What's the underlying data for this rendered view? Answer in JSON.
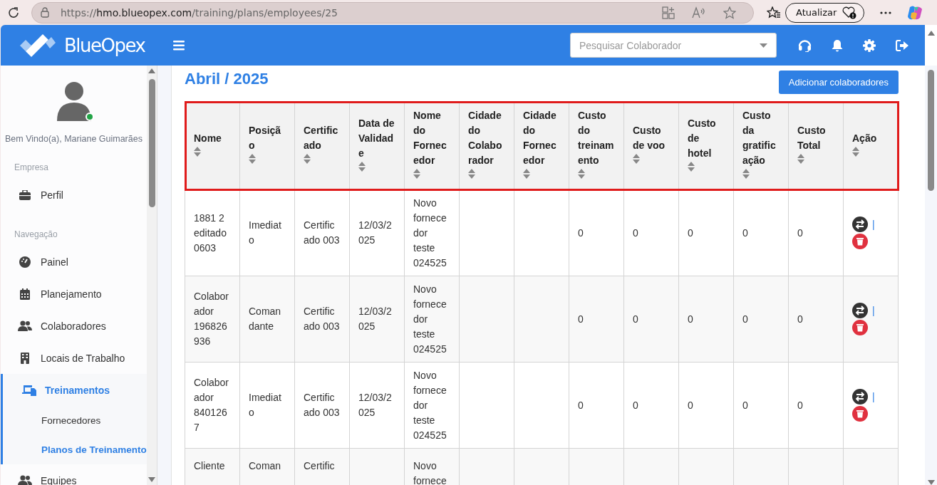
{
  "browser": {
    "url_scheme": "https://",
    "url_host": "hmo.blueopex.com",
    "url_path": "/training/plans/employees/25",
    "update_button": "Atualizar"
  },
  "header": {
    "brand": "BlueOpex",
    "search": {
      "placeholder": "Pesquisar Colaborador"
    }
  },
  "sidebar": {
    "user": {
      "greeting": "Bem Vindo(a), Mariane Guimarães",
      "online": true
    },
    "sections": [
      {
        "title": "Empresa",
        "items": [
          {
            "label": "Perfil",
            "kind": "briefcase",
            "selected": false
          }
        ]
      },
      {
        "title": "Navegação",
        "items": [
          {
            "label": "Painel",
            "kind": "gauge",
            "selected": false
          },
          {
            "label": "Planejamento",
            "kind": "calendar",
            "selected": false
          },
          {
            "label": "Colaboradores",
            "kind": "people",
            "selected": false
          },
          {
            "label": "Locais de Trabalho",
            "kind": "building",
            "selected": false
          },
          {
            "label": "Treinamentos",
            "kind": "devices",
            "selected": true,
            "expanded": true,
            "children": [
              {
                "label": "Fornecedores",
                "selected": false
              },
              {
                "label": "Planos de Treinamento",
                "selected": true
              }
            ]
          },
          {
            "label": "Equipes",
            "kind": "people",
            "selected": false
          }
        ]
      }
    ]
  },
  "page": {
    "title": "Abril / 2025",
    "add_button": "Adicionar colaboradores"
  },
  "table": {
    "header_highlighted": true,
    "columns": [
      "Nome",
      "Posição",
      "Certificado",
      "Data de Validade",
      "Nome do Fornecedor",
      "Cidade do Colaborador",
      "Cidade do Fornecedor",
      "Custo do treinamento",
      "Custo de voo",
      "Custo de hotel",
      "Custo da gratificação",
      "Custo Total",
      "Ação"
    ],
    "rows": [
      {
        "nome": "1881 2 editado 0603",
        "posicao": "Imediato",
        "certificado": "Certificado 003",
        "data_validade": "12/03/2025",
        "fornecedor": "Novo fornecedor teste 024525",
        "custo_treinamento": "0",
        "custo_voo": "0",
        "custo_hotel": "0",
        "custo_gratificacao": "0",
        "custo_total": "0",
        "separator": "|"
      },
      {
        "nome": "Colaborador 196826936",
        "posicao": "Comandante",
        "certificado": "Certificado 003",
        "data_validade": "12/03/2025",
        "fornecedor": "Novo fornecedor teste 024525",
        "custo_treinamento": "0",
        "custo_voo": "0",
        "custo_hotel": "0",
        "custo_gratificacao": "0",
        "custo_total": "0",
        "separator": "|"
      },
      {
        "nome": "Colaborador 8401267",
        "posicao": "Imediato",
        "certificado": "Certificado 003",
        "data_validade": "12/03/2025",
        "fornecedor": "Novo fornecedor teste 024525",
        "custo_treinamento": "0",
        "custo_voo": "0",
        "custo_hotel": "0",
        "custo_gratificacao": "0",
        "custo_total": "0",
        "separator": "|"
      },
      {
        "nome": "Cliente",
        "posicao": "Coman",
        "certificado": "Certific",
        "fornecedor": "Novo fornece"
      }
    ]
  }
}
